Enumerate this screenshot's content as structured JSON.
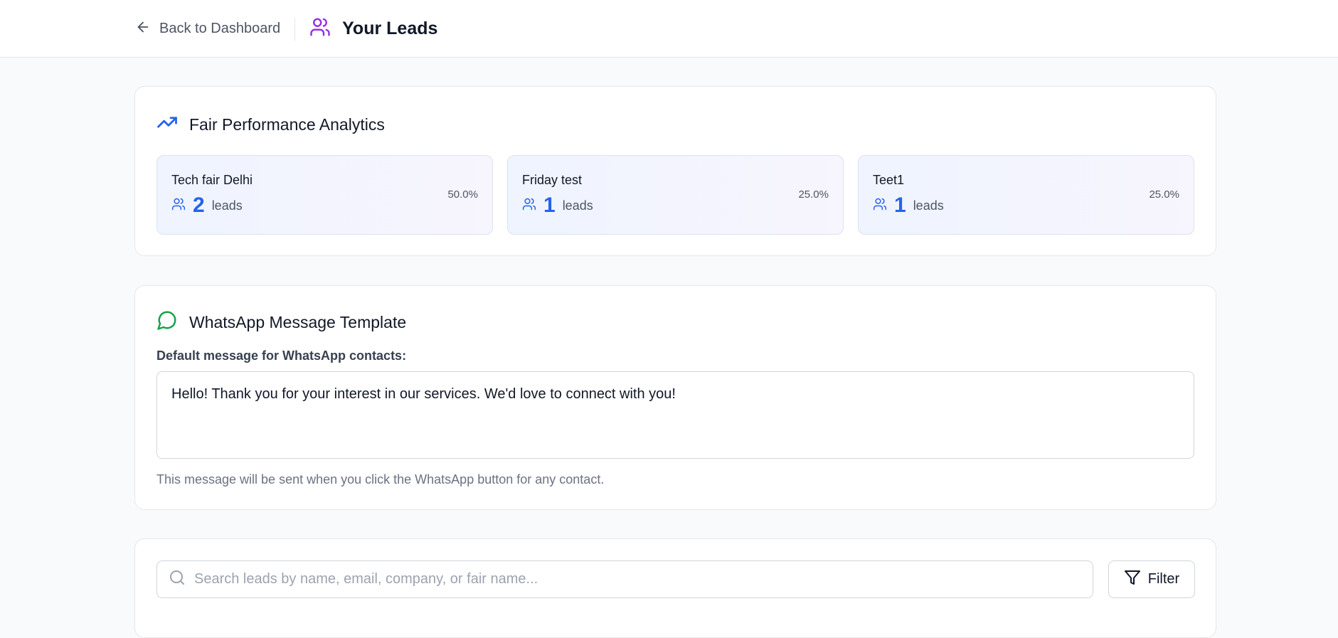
{
  "header": {
    "back_label": "Back to Dashboard",
    "title": "Your Leads"
  },
  "analytics": {
    "title": "Fair Performance Analytics",
    "fairs": [
      {
        "name": "Tech fair Delhi",
        "count": "2",
        "unit": "leads",
        "percent": "50.0%"
      },
      {
        "name": "Friday test",
        "count": "1",
        "unit": "leads",
        "percent": "25.0%"
      },
      {
        "name": "Teet1",
        "count": "1",
        "unit": "leads",
        "percent": "25.0%"
      }
    ]
  },
  "whatsapp": {
    "title": "WhatsApp Message Template",
    "field_label": "Default message for WhatsApp contacts:",
    "message": "Hello! Thank you for your interest in our services. We'd love to connect with you!",
    "helper": "This message will be sent when you click the WhatsApp button for any contact."
  },
  "search": {
    "placeholder": "Search leads by name, email, company, or fair name...",
    "filter_label": "Filter"
  },
  "colors": {
    "accent_blue": "#2563eb",
    "accent_purple": "#9333ea",
    "whatsapp_green": "#16a34a"
  },
  "icons": {
    "back": "arrow-left-icon",
    "leads": "users-icon",
    "analytics": "trending-up-icon",
    "whatsapp": "message-circle-icon",
    "search": "search-icon",
    "filter": "filter-icon"
  }
}
